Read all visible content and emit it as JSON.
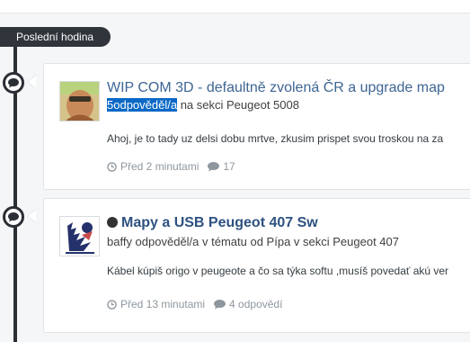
{
  "timeline": {
    "label": "Poslední hodina"
  },
  "items": [
    {
      "title": "WIP COM 3D - defaultně zvolená ČR a upgrade map",
      "unread": false,
      "meta_highlight": "5odpověděl/a",
      "meta_rest": " na sekci Peugeot 5008",
      "snippet": "Ahoj, je to tady uz delsi dobu mrtve, zkusim prispet svou troskou na za",
      "time": "Před 2 minutami",
      "replies": "17"
    },
    {
      "title": "Mapy a USB Peugeot 407 Sw",
      "unread": true,
      "meta_highlight": "",
      "meta_rest": "baffy odpověděl/a v tématu od Pípa v sekci Peugeot 407",
      "snippet": "Kábel kúpiš origo v peugeote a čo sa týka softu ,musíš povedať akú ver",
      "time": "Před 13 minutami",
      "replies": "4 odpovědí"
    }
  ],
  "colors": {
    "link": "#3d6594",
    "highlight": "#0a68c6",
    "timeline": "#2a2f35"
  },
  "icons": [
    "comment-icon",
    "clock-icon",
    "replies-icon"
  ]
}
